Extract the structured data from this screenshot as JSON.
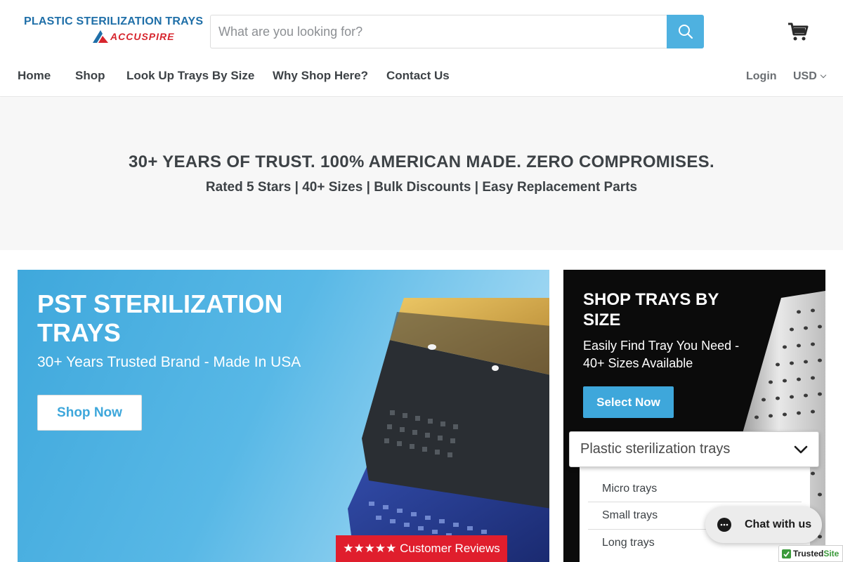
{
  "header": {
    "logo": {
      "line1": "PLASTIC STERILIZATION TRAYS",
      "line2": "ACCUSPIRE"
    },
    "search": {
      "placeholder": "What are you looking for?",
      "value": "",
      "button_icon": "search-icon"
    },
    "cart_icon": "cart-icon"
  },
  "nav": {
    "items": [
      {
        "label": "Home"
      },
      {
        "label": "Shop"
      },
      {
        "label": "Look Up Trays By Size"
      },
      {
        "label": "Why Shop Here?"
      },
      {
        "label": "Contact Us"
      }
    ],
    "login": "Login",
    "currency": "USD"
  },
  "banner": {
    "title": "30+ YEARS OF TRUST. 100% AMERICAN MADE. ZERO COMPROMISES.",
    "subtitle": "Rated 5 Stars | 40+ Sizes | Bulk Discounts | Easy Replacement Parts"
  },
  "hero": {
    "title": "PST STERILIZATION TRAYS",
    "subtitle": "30+ Years Trusted Brand - Made In USA",
    "button": "Shop Now"
  },
  "side_promo": {
    "title": "SHOP TRAYS BY SIZE",
    "subtitle": "Easily Find Tray You Need - 40+ Sizes Available",
    "button": "Select Now"
  },
  "dropdown": {
    "selected": "Plastic sterilization trays",
    "options": [
      "Micro trays",
      "Small trays",
      "Long trays"
    ]
  },
  "reviews_tab": "★★★★★ Customer Reviews",
  "chat": {
    "label": "Chat with us"
  },
  "trusted_badge": {
    "prefix": "Trusted",
    "suffix": "Site"
  },
  "colors": {
    "accent": "#4eb1e0",
    "review_red": "#e01e2d",
    "banner_bg": "#f7f7f7",
    "text": "#3d4246"
  }
}
